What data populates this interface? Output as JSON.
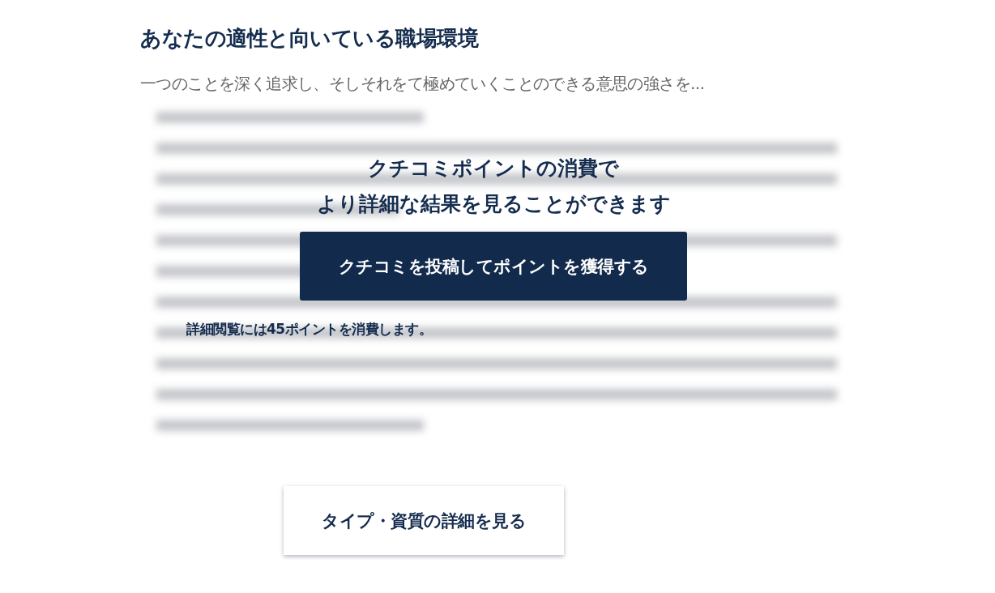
{
  "section": {
    "title": "あなたの適性と向いている職場環境",
    "summary": "一つのことを深く追求し、そしそれをて極めていくことのできる意思の強さを..."
  },
  "locked_overlay": {
    "heading_lines": [
      "クチコミポイントの消費で",
      "より詳細な結果を見ることができます"
    ],
    "button": "クチコミを投稿してポイントを獲得する",
    "note": "詳細閲覧には45ポイントを消費します。"
  },
  "detail_button": "タイプ・資質の詳細を見る"
}
